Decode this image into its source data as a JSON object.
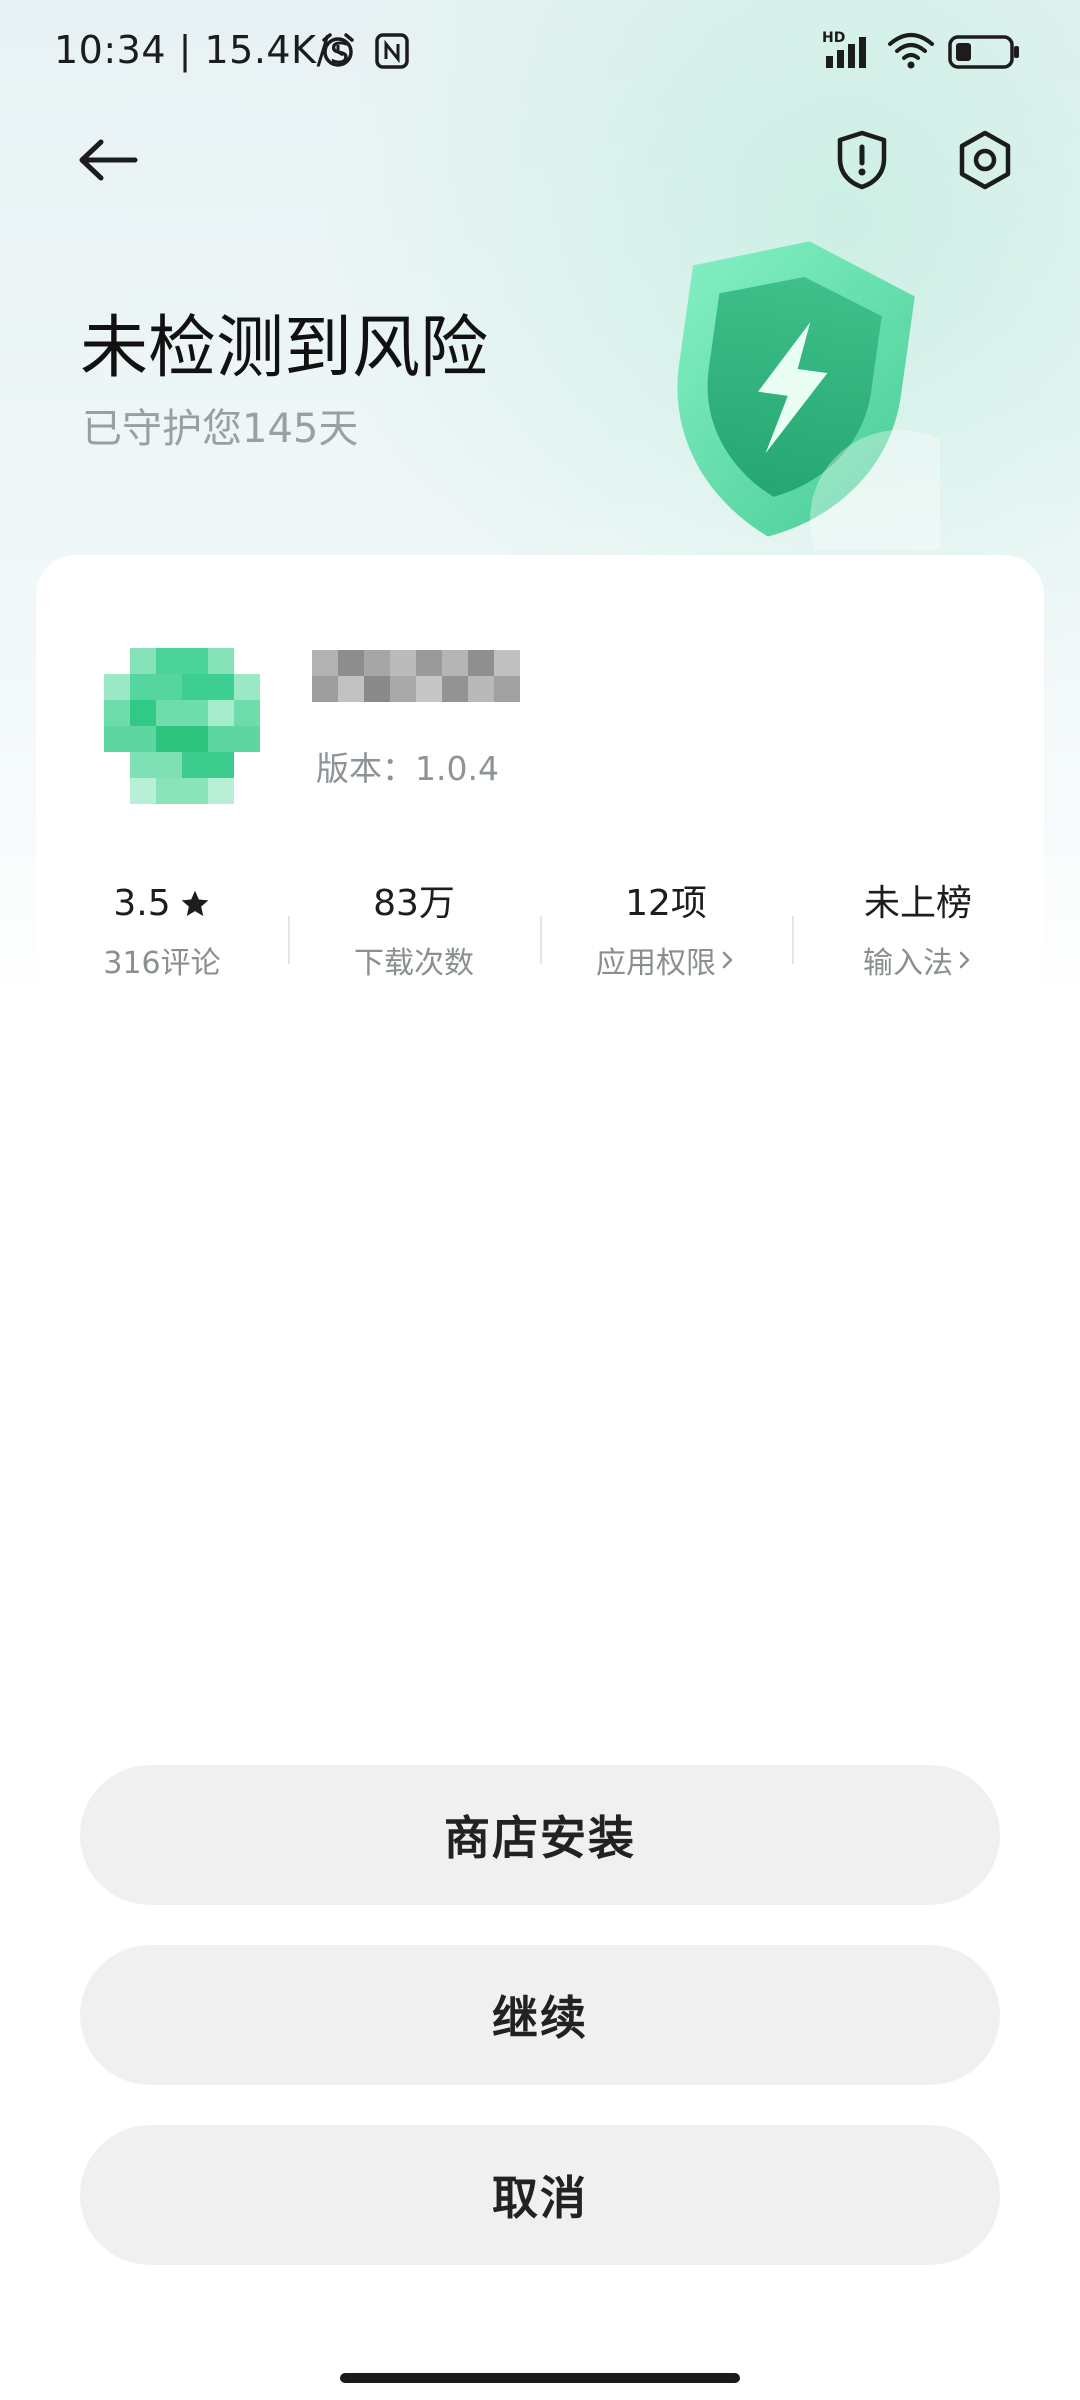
{
  "status_bar": {
    "time_speed": "10:34 | 15.4K/s",
    "network_badge": "HD",
    "icons": [
      "alarm-icon",
      "nfc-icon",
      "signal-icon",
      "wifi-icon",
      "battery-icon"
    ],
    "battery_level": 0.3
  },
  "header": {
    "back_icon": "back-arrow-icon",
    "actions": [
      "shield-alert-icon",
      "settings-gear-icon"
    ]
  },
  "hero": {
    "title": "未检测到风险",
    "subtitle": "已守护您145天"
  },
  "app_card": {
    "version": "版本：1.0.4",
    "stats": [
      {
        "value": "3.5",
        "label": "316评论",
        "icon": "star-icon",
        "chevron": false
      },
      {
        "value": "83万",
        "label": "下载次数",
        "chevron": false
      },
      {
        "value": "12项",
        "label": "应用权限",
        "chevron": true
      },
      {
        "value": "未上榜",
        "label": "输入法",
        "chevron": true
      }
    ]
  },
  "actions": {
    "store_install": "商店安装",
    "continue": "继续",
    "cancel": "取消"
  },
  "colors": {
    "accent_green": "#3fd59a",
    "button_bg": "#f0f0f0",
    "muted_text": "#9aa0a2"
  }
}
